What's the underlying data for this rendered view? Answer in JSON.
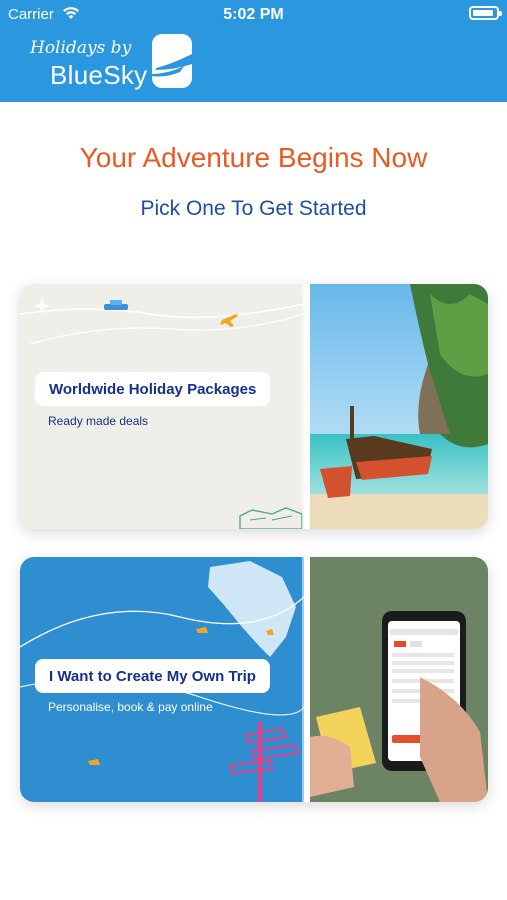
{
  "status_bar": {
    "carrier": "Carrier",
    "time": "5:02 PM"
  },
  "brand": {
    "script_text": "Holidays by",
    "word_text": "BlueSky"
  },
  "heading": {
    "title": "Your Adventure Begins Now",
    "subtitle": "Pick One To Get Started"
  },
  "cards": [
    {
      "title": "Worldwide Holiday Packages",
      "caption": "Ready made deals",
      "image": "beach-longtail-boat-photo"
    },
    {
      "title": "I Want to Create My Own Trip",
      "caption": "Personalise, book & pay online",
      "image": "phone-booking-app-photo"
    }
  ],
  "colors": {
    "header": "#2b97de",
    "title": "#ea5a23",
    "subtitle": "#1c4fa1",
    "card_label": "#17308a"
  },
  "icons": [
    "wifi-icon",
    "battery-icon",
    "bluesky-logo-icon",
    "plane-icon",
    "ship-icon",
    "sparkle-icon",
    "signpost-icon"
  ]
}
